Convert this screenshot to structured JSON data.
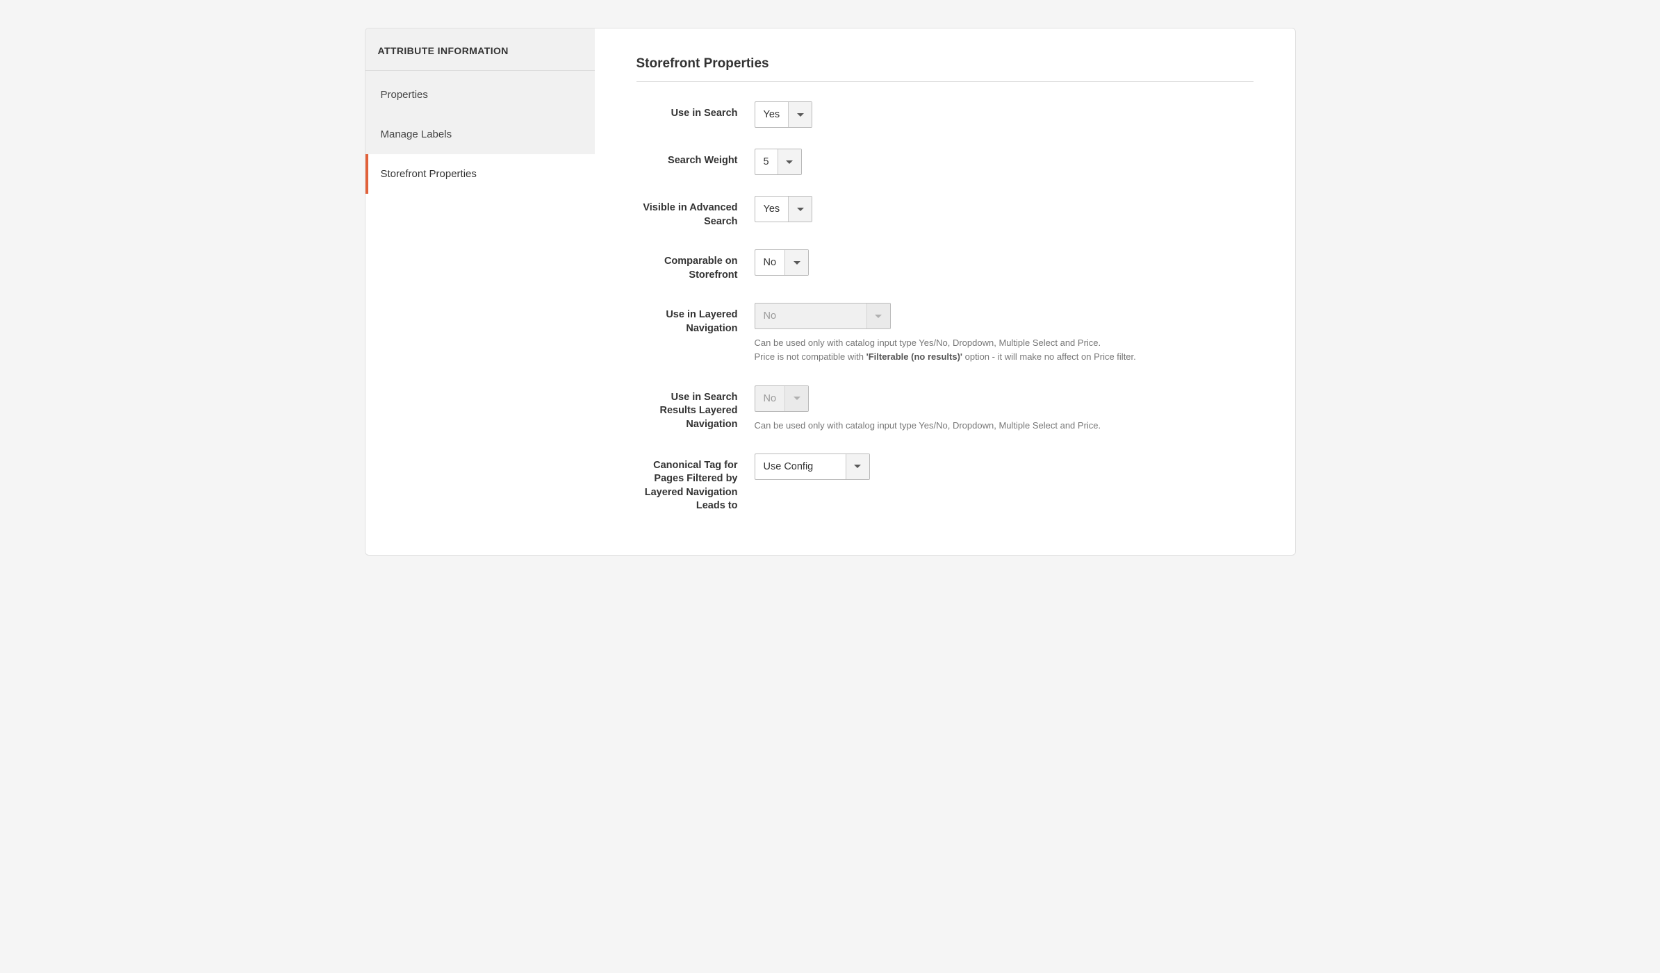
{
  "sidebar": {
    "header": "ATTRIBUTE INFORMATION",
    "items": [
      {
        "label": "Properties",
        "active": false
      },
      {
        "label": "Manage Labels",
        "active": false
      },
      {
        "label": "Storefront Properties",
        "active": true
      }
    ]
  },
  "main": {
    "section_title": "Storefront Properties",
    "fields": {
      "use_in_search": {
        "label": "Use in Search",
        "value": "Yes"
      },
      "search_weight": {
        "label": "Search Weight",
        "value": "5"
      },
      "visible_advanced": {
        "label": "Visible in Advanced Search",
        "value": "Yes"
      },
      "comparable": {
        "label": "Comparable on Storefront",
        "value": "No"
      },
      "layered_nav": {
        "label": "Use in Layered Navigation",
        "value": "No",
        "helper_pre": "Can be used only with catalog input type Yes/No, Dropdown, Multiple Select and Price.",
        "helper_line2a": "Price is not compatible with ",
        "helper_bold": "'Filterable (no results)'",
        "helper_line2b": " option - it will make no affect on Price filter."
      },
      "search_layered_nav": {
        "label": "Use in Search Results Layered Navigation",
        "value": "No",
        "helper": "Can be used only with catalog input type Yes/No, Dropdown, Multiple Select and Price."
      },
      "canonical": {
        "label": "Canonical Tag for Pages Filtered by Layered Navigation Leads to",
        "value": "Use Config"
      }
    }
  }
}
